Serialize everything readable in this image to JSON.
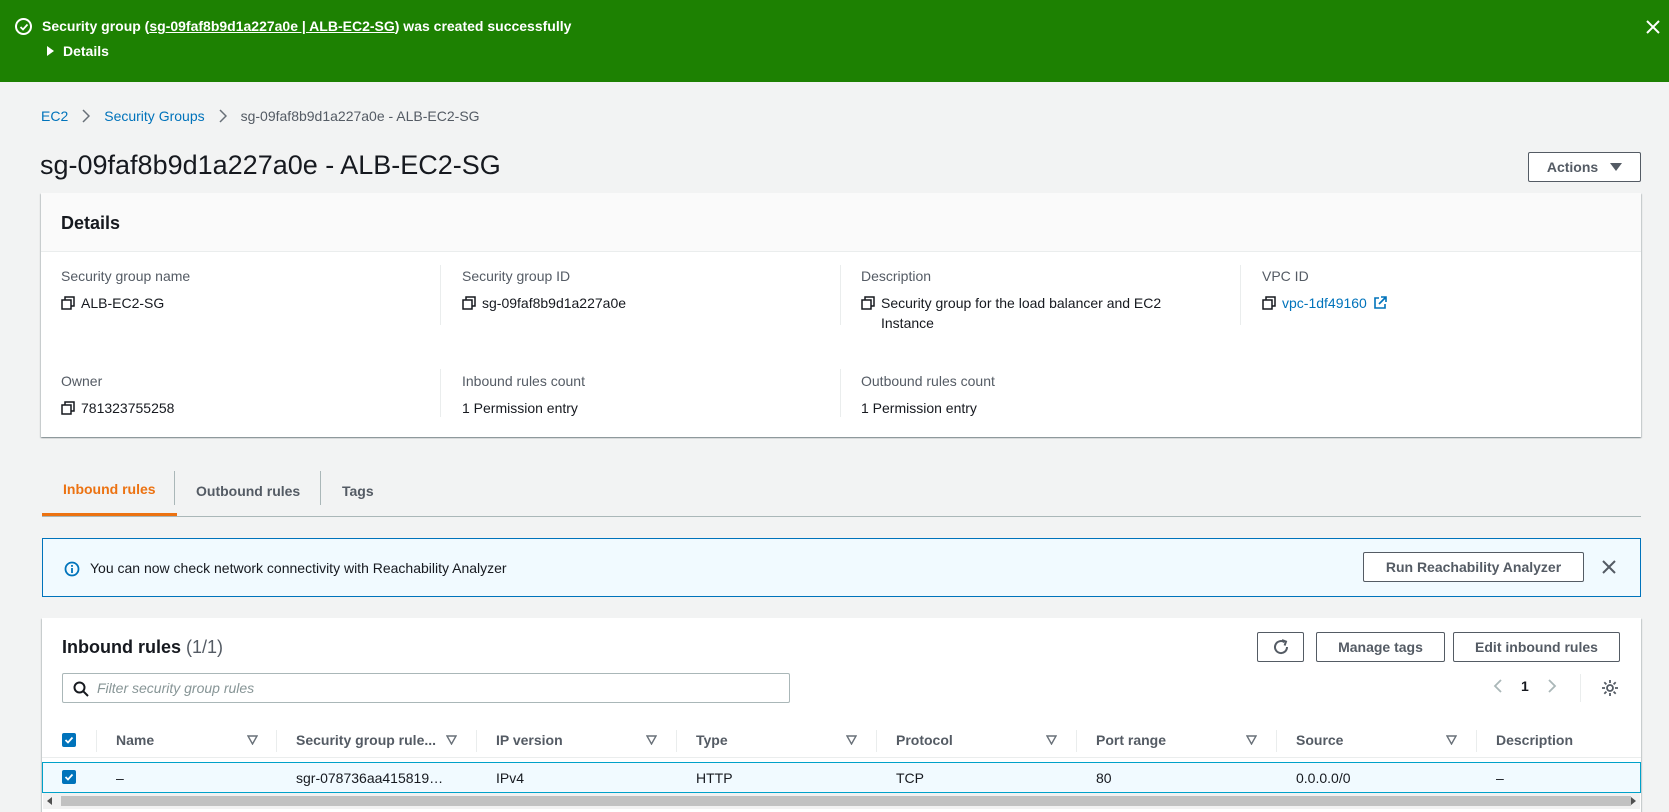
{
  "flash": {
    "prefix": "Security group (",
    "link": "sg-09faf8b9d1a227a0e | ALB-EC2-SG",
    "suffix": ") was created successfully",
    "details_label": "Details",
    "background_color": "#1d8102"
  },
  "breadcrumb": {
    "items": [
      "EC2",
      "Security Groups"
    ],
    "current": "sg-09faf8b9d1a227a0e - ALB-EC2-SG"
  },
  "page": {
    "title": "sg-09faf8b9d1a227a0e - ALB-EC2-SG",
    "actions_label": "Actions"
  },
  "details": {
    "header": "Details",
    "fields": [
      {
        "label": "Security group name",
        "value": "ALB-EC2-SG"
      },
      {
        "label": "Security group ID",
        "value": "sg-09faf8b9d1a227a0e"
      },
      {
        "label": "Description",
        "value": "Security group for the load balancer and EC2 Instance"
      },
      {
        "label": "VPC ID",
        "value": "vpc-1df49160"
      },
      {
        "label": "Owner",
        "value": "781323755258"
      },
      {
        "label": "Inbound rules count",
        "value": "1 Permission entry"
      },
      {
        "label": "Outbound rules count",
        "value": "1 Permission entry"
      }
    ]
  },
  "tabs": [
    {
      "label": "Inbound rules",
      "active": true
    },
    {
      "label": "Outbound rules",
      "active": false
    },
    {
      "label": "Tags",
      "active": false
    }
  ],
  "alert": {
    "text": "You can now check network connectivity with Reachability Analyzer",
    "button_label": "Run Reachability Analyzer"
  },
  "rules": {
    "title": "Inbound rules",
    "count": "(1/1)",
    "manage_tags_label": "Manage tags",
    "edit_label": "Edit inbound rules",
    "search_placeholder": "Filter security group rules",
    "page_number": "1",
    "columns": [
      "Name",
      "Security group rule...",
      "IP version",
      "Type",
      "Protocol",
      "Port range",
      "Source",
      "Description"
    ],
    "rows": [
      [
        "–",
        "sgr-078736aa415819…",
        "IPv4",
        "HTTP",
        "TCP",
        "80",
        "0.0.0.0/0",
        "–"
      ]
    ]
  },
  "colors": {
    "link": "#0073bb",
    "active_tab": "#ec7211",
    "info_bg": "#f1faff"
  }
}
